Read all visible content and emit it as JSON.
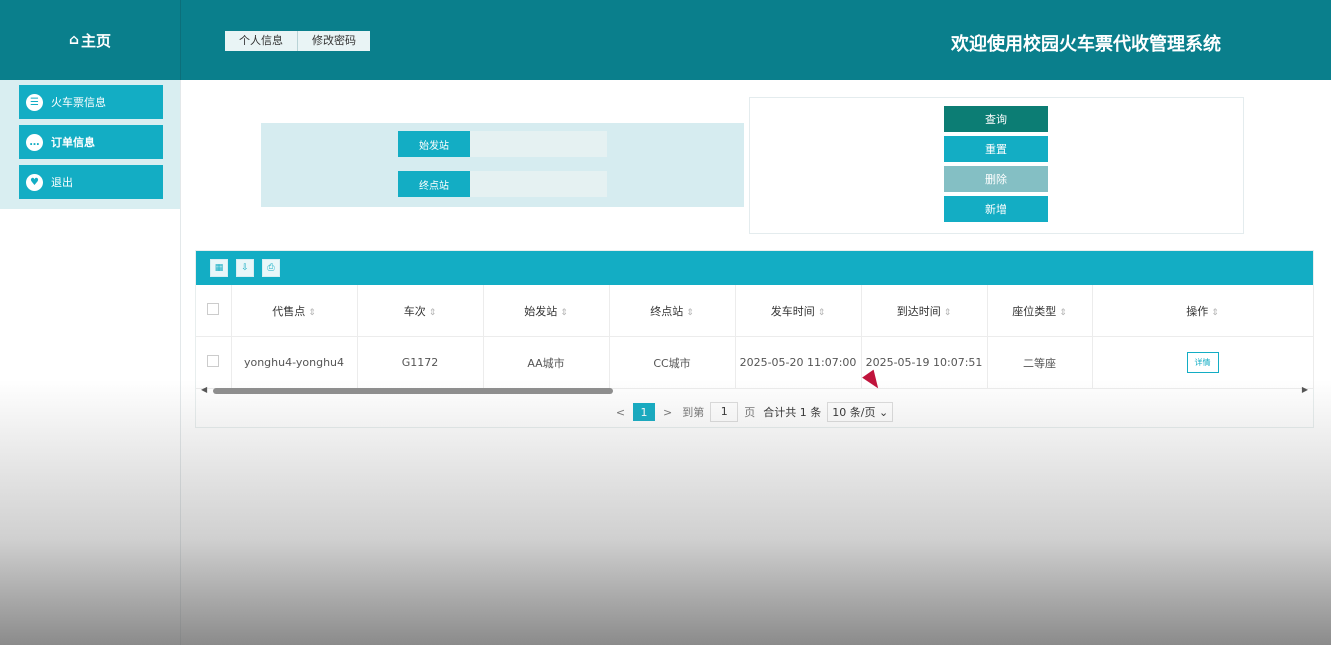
{
  "header": {
    "home_glyph": "⌂",
    "home_label": "主页",
    "tabs": [
      "个人信息",
      "修改密码"
    ],
    "title": "欢迎使用校园火车票代收管理系统"
  },
  "sidebar": {
    "items": [
      {
        "label": "火车票信息",
        "icon": "list-icon"
      },
      {
        "label": "订单信息",
        "icon": "chat-icon"
      },
      {
        "label": "退出",
        "icon": "heart-icon"
      }
    ]
  },
  "search": {
    "start_label": "始发站",
    "end_label": "终点站",
    "start_value": "",
    "end_value": ""
  },
  "actions": {
    "query": "查询",
    "reset": "重置",
    "delete": "删除",
    "add": "新增"
  },
  "colors": {
    "header": "#0a7f8c",
    "accent": "#13adc4",
    "query_btn": "#0c7d74",
    "delete_btn": "#84bfc4",
    "search_bg": "#d6ecf0"
  },
  "table": {
    "toolbar_icons": [
      "grid-icon",
      "export-icon",
      "print-icon"
    ],
    "columns": [
      "代售点",
      "车次",
      "始发站",
      "终点站",
      "发车时间",
      "到达时间",
      "座位类型",
      "操作"
    ],
    "rows": [
      {
        "agent": "yonghu4-yonghu4",
        "train": "G1172",
        "from": "AA城市",
        "to": "CC城市",
        "depart": "2025-05-20 11:07:00",
        "arrive": "2025-05-19 10:07:51",
        "seat": "二等座",
        "detail": "详情"
      }
    ]
  },
  "pager": {
    "prev": "<",
    "current": "1",
    "next": ">",
    "goto_label": "到第",
    "goto_value": "1",
    "page_unit": "页",
    "total": "合计共 1 条",
    "size": "10 条/页"
  }
}
